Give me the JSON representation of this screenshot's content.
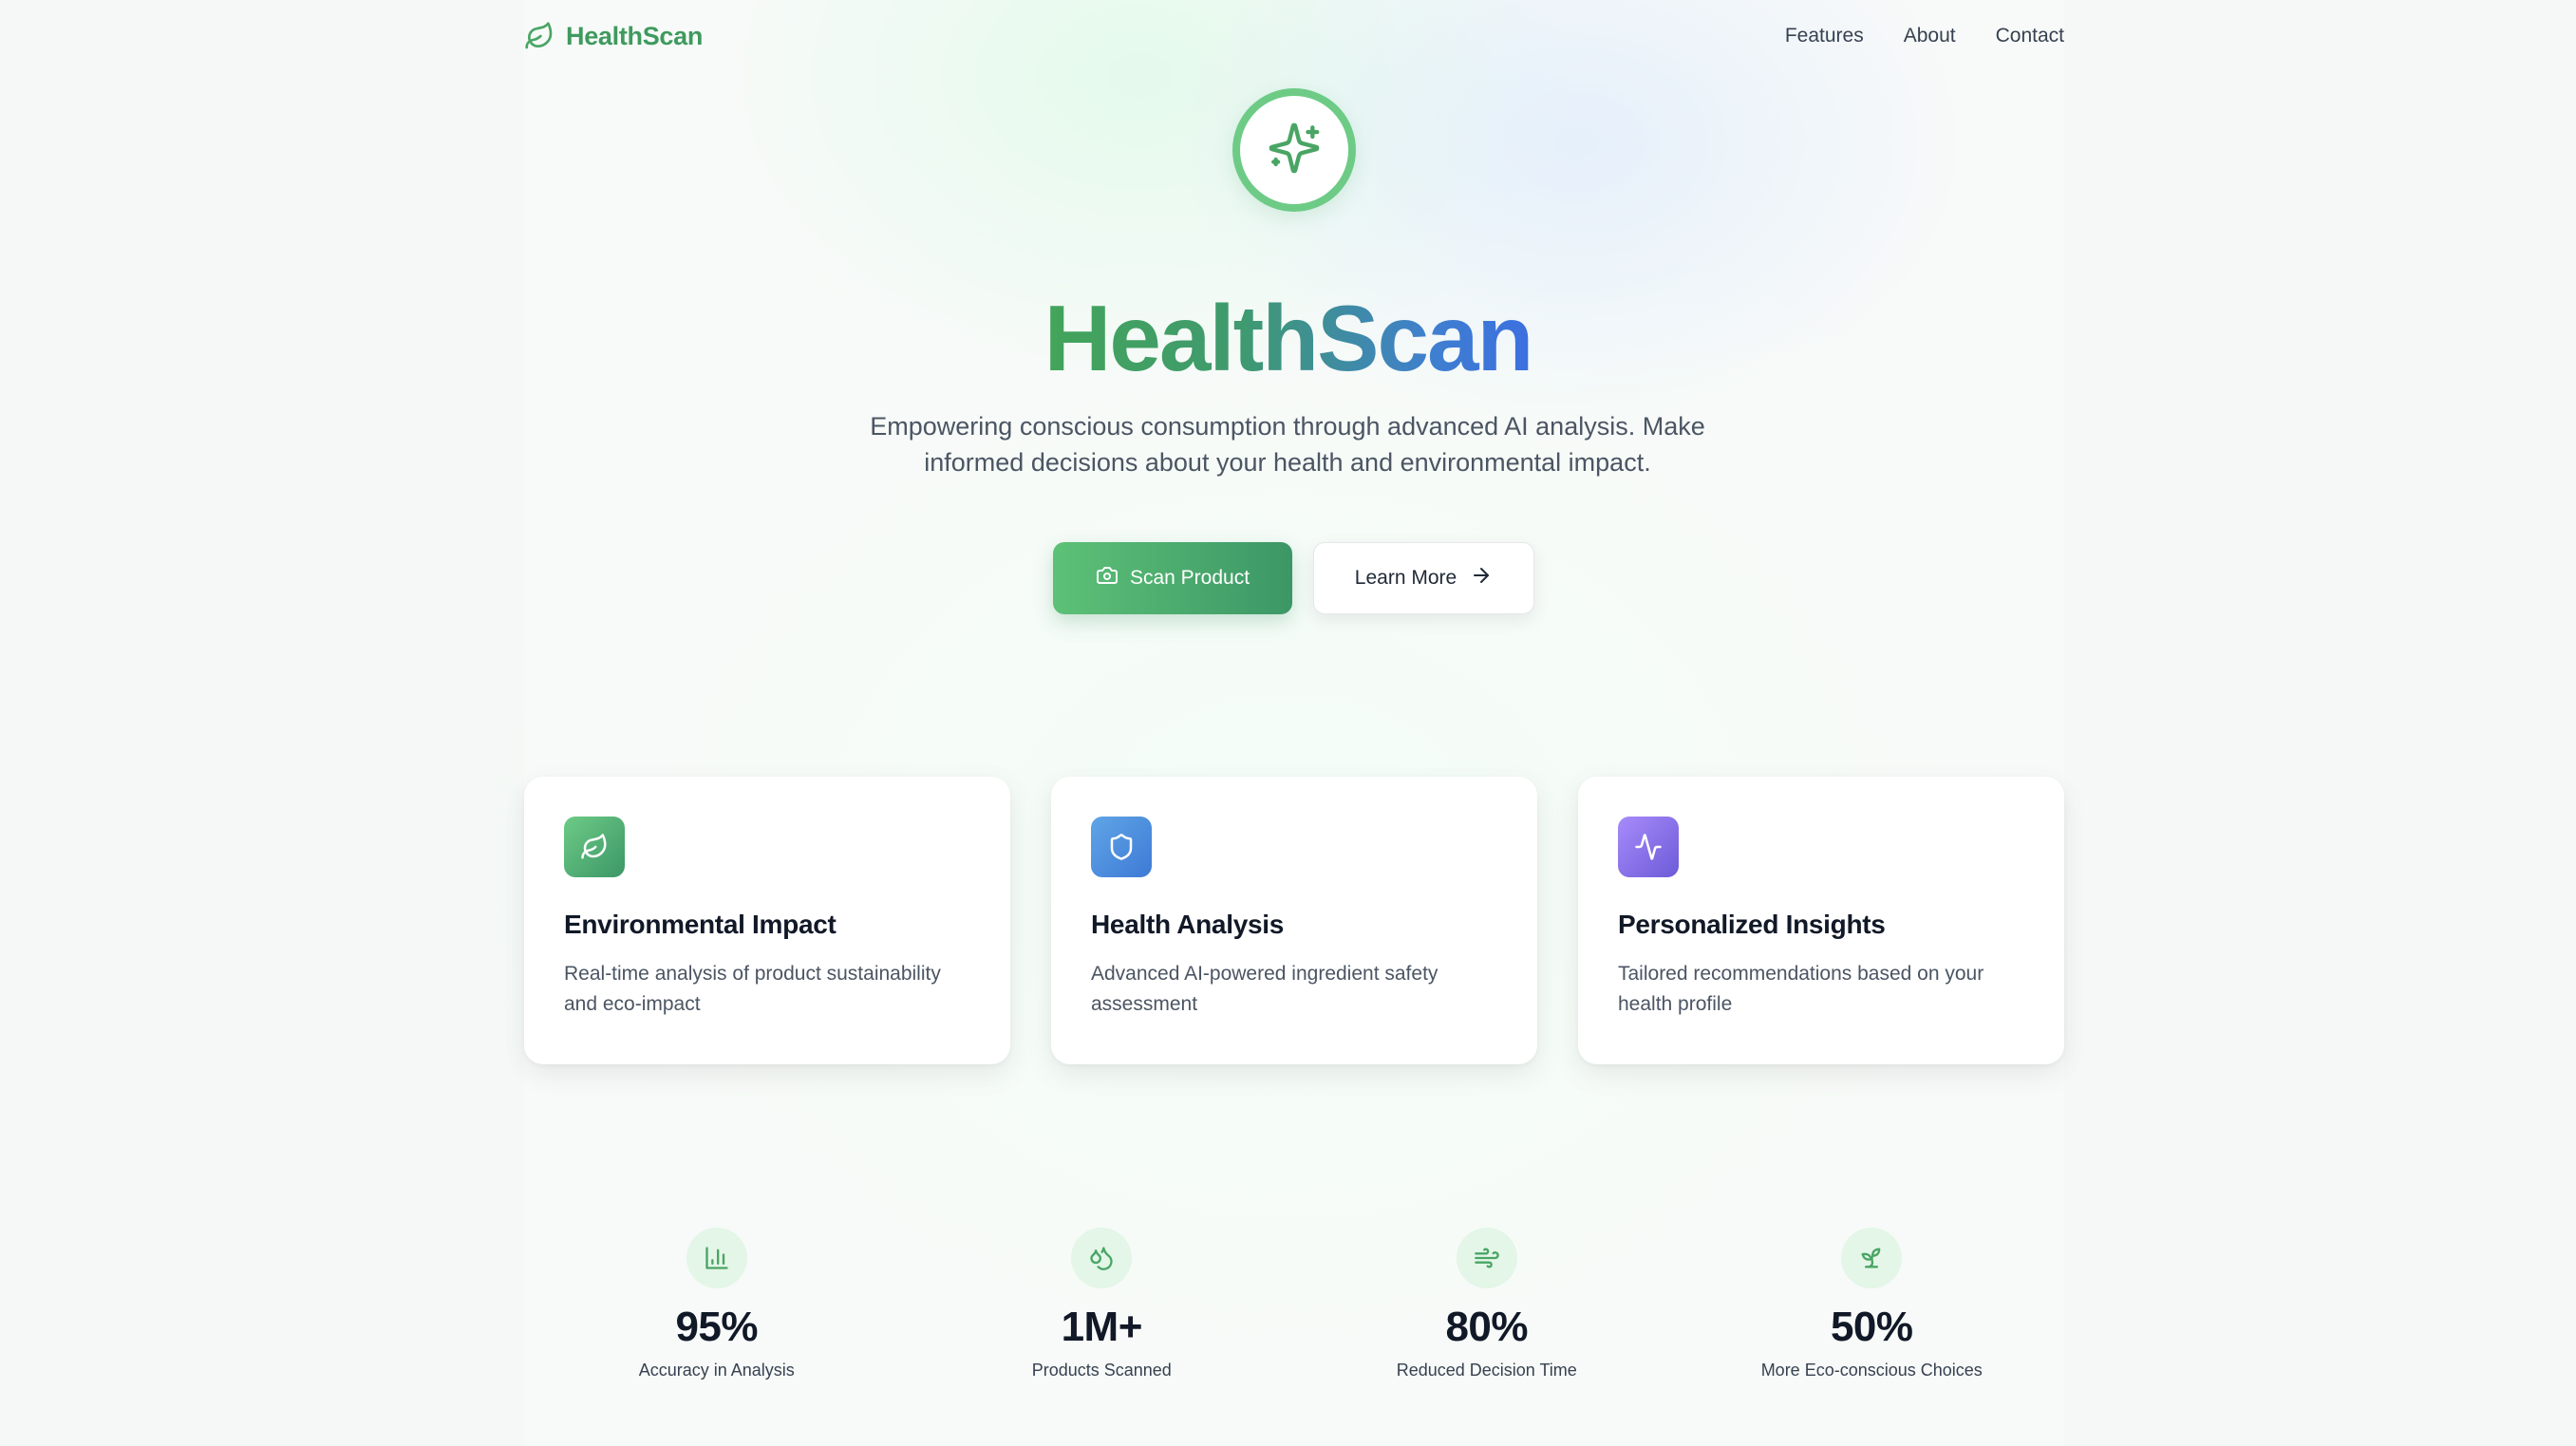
{
  "nav": {
    "brand": "HealthScan",
    "brand_icon": "leaf-icon",
    "links": [
      "Features",
      "About",
      "Contact"
    ]
  },
  "hero": {
    "badge_icon": "sparkles-icon",
    "title": "HealthScan",
    "subtitle": "Empowering conscious consumption through advanced AI analysis. Make informed decisions about your health and environmental impact.",
    "primary_button": "Scan Product",
    "primary_button_icon": "camera-icon",
    "secondary_button": "Learn More",
    "secondary_button_icon": "arrow-right-icon"
  },
  "features": [
    {
      "icon": "leaf-icon",
      "title": "Environmental Impact",
      "description": "Real-time analysis of product sustainability and eco-impact"
    },
    {
      "icon": "shield-icon",
      "title": "Health Analysis",
      "description": "Advanced AI-powered ingredient safety assessment"
    },
    {
      "icon": "activity-icon",
      "title": "Personalized Insights",
      "description": "Tailored recommendations based on your health profile"
    }
  ],
  "stats": [
    {
      "icon": "bar-chart-icon",
      "value": "95%",
      "label": "Accuracy in Analysis"
    },
    {
      "icon": "droplets-icon",
      "value": "1M+",
      "label": "Products Scanned"
    },
    {
      "icon": "wind-icon",
      "value": "80%",
      "label": "Reduced Decision Time"
    },
    {
      "icon": "sprout-icon",
      "value": "50%",
      "label": "More Eco-conscious Choices"
    }
  ],
  "colors": {
    "brand_green": "#3f9a5e",
    "accent_green": "#6dcb86",
    "accent_blue": "#3e7ad6",
    "accent_purple": "#6d5bd8"
  }
}
